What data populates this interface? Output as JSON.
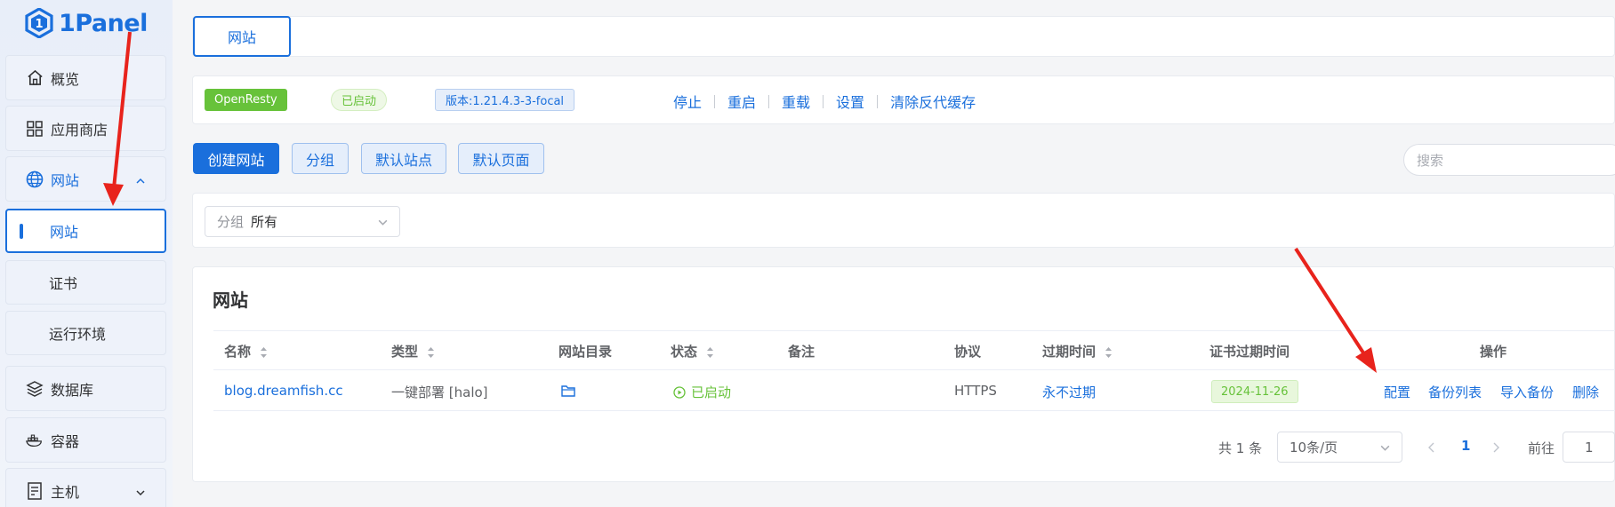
{
  "brand": {
    "logo_text": "1Panel"
  },
  "sidebar": {
    "items": [
      {
        "label": "概览",
        "icon": "home-icon"
      },
      {
        "label": "应用商店",
        "icon": "grid-icon"
      },
      {
        "label": "网站",
        "icon": "globe-icon",
        "expanded": true
      },
      {
        "label": "网站",
        "active": true
      },
      {
        "label": "证书"
      },
      {
        "label": "运行环境"
      },
      {
        "label": "数据库",
        "icon": "layers-icon"
      },
      {
        "label": "容器",
        "icon": "docker-icon"
      },
      {
        "label": "主机",
        "icon": "server-icon"
      }
    ]
  },
  "tabs": {
    "active": "网站"
  },
  "openresty": {
    "name": "OpenResty",
    "status": "已启动",
    "version": "版本:1.21.4.3-3-focal",
    "actions": [
      "停止",
      "重启",
      "重载",
      "设置",
      "清除反代缓存"
    ]
  },
  "toolbar": {
    "create": "创建网站",
    "group": "分组",
    "default_site": "默认站点",
    "default_page": "默认页面",
    "search_placeholder": "搜索"
  },
  "filter": {
    "label": "分组",
    "value": "所有"
  },
  "table": {
    "title": "网站",
    "headers": [
      "名称",
      "类型",
      "网站目录",
      "状态",
      "备注",
      "协议",
      "过期时间",
      "证书过期时间",
      "操作"
    ],
    "rows": [
      {
        "name": "blog.dreamfish.cc",
        "type": "一键部署 [halo]",
        "status": "已启动",
        "remark": "",
        "protocol": "HTTPS",
        "expire": "永不过期",
        "cert_expire": "2024-11-26",
        "actions": [
          "配置",
          "备份列表",
          "导入备份",
          "删除"
        ]
      }
    ]
  },
  "pagination": {
    "total": "共 1 条",
    "page_size": "10条/页",
    "current": "1",
    "goto_label": "前往",
    "goto_value": "1"
  },
  "colors": {
    "primary": "#1a6fdc",
    "success": "#67c23a",
    "annotation": "#e8231c"
  }
}
